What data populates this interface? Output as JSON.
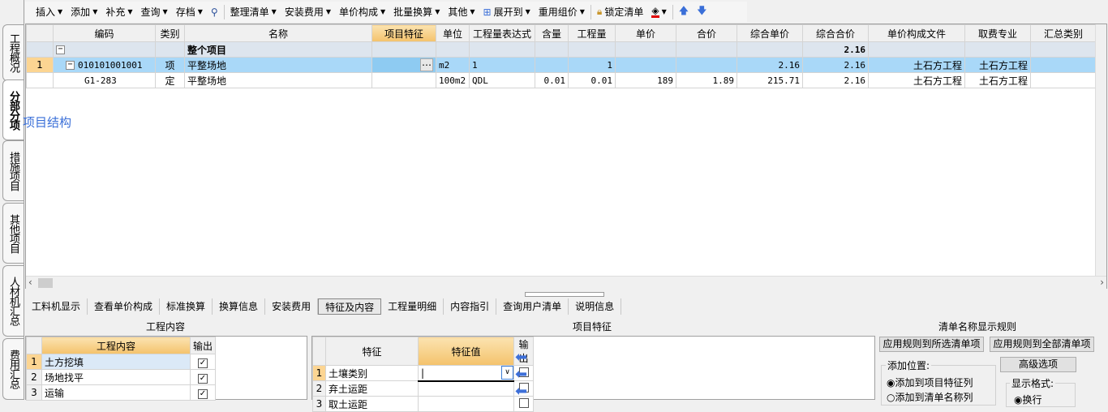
{
  "sidebar": {
    "tabs": [
      "工程概况",
      "分部分项",
      "措施项目",
      "其他项目",
      "人材机汇总",
      "费用汇总"
    ]
  },
  "toolbar": {
    "items": [
      "插入",
      "添加",
      "补充",
      "查询",
      "存档",
      "整理清单",
      "安装费用",
      "单价构成",
      "批量换算",
      "其他",
      "展开到",
      "重用组价",
      "锁定清单"
    ]
  },
  "grid": {
    "columns": [
      "",
      "编码",
      "类别",
      "名称",
      "项目特征",
      "单位",
      "工程量表达式",
      "含量",
      "工程量",
      "单价",
      "合价",
      "综合单价",
      "综合合价",
      "单价构成文件",
      "取费专业",
      "汇总类别"
    ],
    "rows": [
      [
        "",
        "",
        "",
        "整个项目",
        "",
        "",
        "",
        "",
        "",
        "",
        "",
        "",
        "2.16",
        "",
        "",
        ""
      ],
      [
        "1",
        "010101001001",
        "项",
        "平整场地",
        "",
        "m2",
        "1",
        "",
        "1",
        "",
        "",
        "2.16",
        "2.16",
        "土石方工程",
        "土石方工程",
        ""
      ],
      [
        "",
        "G1-283",
        "定",
        "平整场地",
        "",
        "100m2",
        "QDL",
        "0.01",
        "0.01",
        "189",
        "1.89",
        "215.71",
        "2.16",
        "土石方工程",
        "土石方工程",
        ""
      ]
    ]
  },
  "structure_label": "项目结构",
  "bottom_tabs": [
    "工料机显示",
    "查看单价构成",
    "标准换算",
    "换算信息",
    "安装费用",
    "特征及内容",
    "工程量明细",
    "内容指引",
    "查询用户清单",
    "说明信息"
  ],
  "work_content": {
    "title": "工程内容",
    "headers": [
      "工程内容",
      "输出"
    ],
    "rows": [
      {
        "n": "1",
        "name": "土方挖填"
      },
      {
        "n": "2",
        "name": "场地找平"
      },
      {
        "n": "3",
        "name": "运输"
      }
    ]
  },
  "features": {
    "title": "项目特征",
    "headers": [
      "特征",
      "特征值",
      "输出"
    ],
    "rows": [
      {
        "n": "1",
        "name": "土壤类别",
        "value": "|"
      },
      {
        "n": "2",
        "name": "弃土运距",
        "value": ""
      },
      {
        "n": "3",
        "name": "取土运距",
        "value": ""
      }
    ]
  },
  "rules": {
    "title": "清单名称显示规则",
    "apply_selected": "应用规则到所选清单项",
    "apply_all": "应用规则到全部清单项",
    "advanced": "高级选项",
    "position_label": "添加位置:",
    "pos_opt1": "添加到项目特征列",
    "pos_opt2": "添加到清单名称列",
    "format_label": "显示格式:",
    "fmt_opt1": "换行"
  }
}
